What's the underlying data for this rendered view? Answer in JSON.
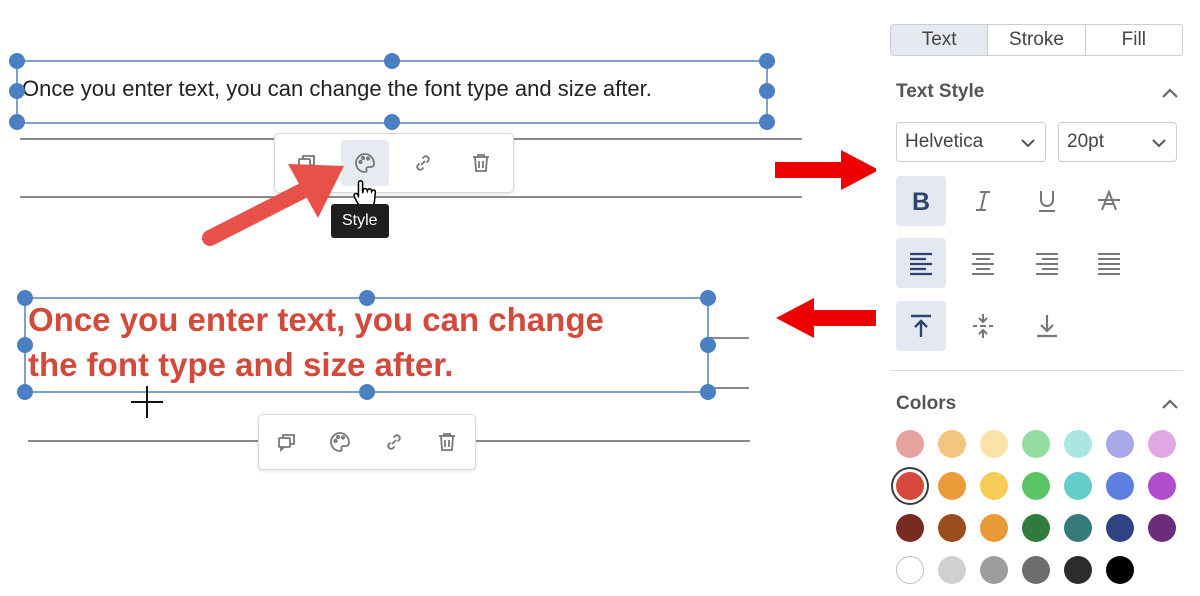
{
  "canvas": {
    "text_box_1": "Once you enter text, you can change the font type and size after.",
    "text_box_2_line_1": "Once you enter text, you can change",
    "text_box_2_line_2": "the font type and size after.",
    "tooltip": "Style",
    "toolbar_icons": [
      "duplicate-icon",
      "palette-icon",
      "link-icon",
      "trash-icon"
    ]
  },
  "panel": {
    "tabs": [
      "Text",
      "Stroke",
      "Fill"
    ],
    "selected_tab": "Text",
    "text_style": {
      "title": "Text Style",
      "font_family": "Helvetica",
      "font_size": "20pt",
      "format_buttons": [
        "bold",
        "italic",
        "underline",
        "strikethrough"
      ],
      "align_buttons": [
        "align-left",
        "align-center",
        "align-right",
        "justify"
      ],
      "vertical_buttons": [
        "align-top",
        "align-middle",
        "align-bottom"
      ],
      "active": [
        "bold",
        "align-left",
        "align-top"
      ]
    },
    "colors": {
      "title": "Colors",
      "selected": "#d6483b",
      "rows": [
        [
          "#e6a39e",
          "#f4c580",
          "#fbe3a6",
          "#93dca2",
          "#a9e6e4",
          "#a9a9e9",
          "#e2a8e6"
        ],
        [
          "#d6483b",
          "#ec9b3b",
          "#f6cc57",
          "#5bc467",
          "#62cdcb",
          "#5d7fe2",
          "#b14dcc"
        ],
        [
          "#7b2a22",
          "#9c4d1e",
          "#e99a38",
          "#2f7a3c",
          "#357b7a",
          "#2f4382",
          "#6b2c7a"
        ],
        [
          "#ffffff",
          "#d0d0d0",
          "#9d9d9d",
          "#6d6d6d",
          "#2d2d2d",
          "#000000"
        ]
      ]
    }
  },
  "accent_colors": {
    "arrow_red": "#ee0000",
    "pointer_red": "#e8504a",
    "handle_blue": "#4a7fc1",
    "styled_text": "#d24a3b"
  }
}
